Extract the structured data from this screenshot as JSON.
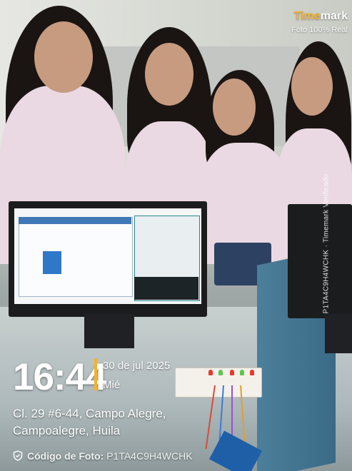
{
  "watermark": {
    "brand_prefix": "Time",
    "brand_suffix": "mark",
    "subtitle": "Foto 100% Real",
    "side_code": "P1TA4C9H4WCHK · Timemark Verificado"
  },
  "stamp": {
    "time": "16:44",
    "date": "30 de jul 2025",
    "weekday": "Mié",
    "address_line1": "Cl. 29 #6-44, Campo Alegre,",
    "address_line2": "Campoalegre, Huila",
    "code_label": "Código de Foto:",
    "code_value": "P1TA4C9H4WCHK"
  },
  "colors": {
    "accent": "#f6b22a",
    "led_red": "#e33b2e",
    "led_green": "#5ec44f"
  }
}
